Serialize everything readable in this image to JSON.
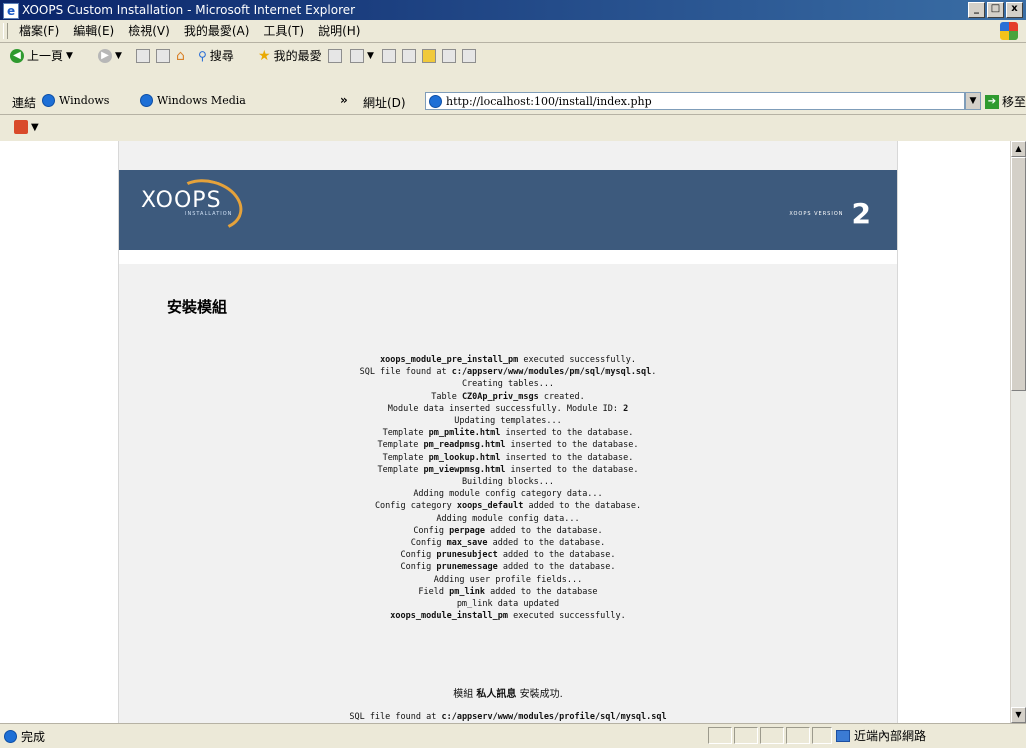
{
  "window": {
    "title": "XOOPS Custom Installation - Microsoft Internet Explorer",
    "min_label": "_",
    "max_label": "□",
    "close_label": "x"
  },
  "menu": [
    "檔案(F)",
    "編輯(E)",
    "檢視(V)",
    "我的最愛(A)",
    "工具(T)",
    "說明(H)"
  ],
  "toolbar": {
    "back_label": "上一頁",
    "search_label": "搜尋",
    "favorites_label": "我的最愛"
  },
  "links_bar": {
    "label": "連結",
    "links": [
      "Windows",
      "Windows Media"
    ],
    "chevron": "»"
  },
  "address": {
    "label": "網址(D)",
    "url": "http://localhost:100/install/index.php",
    "go_label": "移至"
  },
  "page": {
    "logo_text": "XOOPS",
    "logo_sub": "INSTALLATION",
    "version_label": "XOOPS VERSION",
    "version_number": "2",
    "heading": "安裝模組",
    "log_lines": [
      [
        {
          "b": "xoops_module_pre_install_pm"
        },
        {
          "t": " executed successfully."
        }
      ],
      [
        {
          "t": "SQL file found at "
        },
        {
          "b": "c:/appserv/www/modules/pm/sql/mysql.sql"
        },
        {
          "t": "."
        }
      ],
      [
        {
          "t": "Creating tables..."
        }
      ],
      [
        {
          "t": "Table "
        },
        {
          "b": "CZ0Ap_priv_msgs"
        },
        {
          "t": " created."
        }
      ],
      [
        {
          "t": "Module data inserted successfully. Module ID: "
        },
        {
          "b": "2"
        }
      ],
      [
        {
          "t": "Updating templates..."
        }
      ],
      [
        {
          "t": "Template "
        },
        {
          "b": "pm_pmlite.html"
        },
        {
          "t": " inserted to the database."
        }
      ],
      [
        {
          "t": "Template "
        },
        {
          "b": "pm_readpmsg.html"
        },
        {
          "t": " inserted to the database."
        }
      ],
      [
        {
          "t": "Template "
        },
        {
          "b": "pm_lookup.html"
        },
        {
          "t": " inserted to the database."
        }
      ],
      [
        {
          "t": "Template "
        },
        {
          "b": "pm_viewpmsg.html"
        },
        {
          "t": " inserted to the database."
        }
      ],
      [
        {
          "t": "Building blocks..."
        }
      ],
      [
        {
          "t": "Adding module config category data..."
        }
      ],
      [
        {
          "t": "Config category "
        },
        {
          "b": "xoops_default"
        },
        {
          "t": " added to the database."
        }
      ],
      [
        {
          "t": "Adding module config data..."
        }
      ],
      [
        {
          "t": "Config "
        },
        {
          "b": "perpage"
        },
        {
          "t": " added to the database."
        }
      ],
      [
        {
          "t": "Config "
        },
        {
          "b": "max_save"
        },
        {
          "t": " added to the database."
        }
      ],
      [
        {
          "t": "Config "
        },
        {
          "b": "prunesubject"
        },
        {
          "t": " added to the database."
        }
      ],
      [
        {
          "t": "Config "
        },
        {
          "b": "prunemessage"
        },
        {
          "t": " added to the database."
        }
      ],
      [
        {
          "t": "Adding user profile fields..."
        }
      ],
      [
        {
          "t": "Field "
        },
        {
          "b": "pm_link"
        },
        {
          "t": " added to the database"
        }
      ],
      [
        {
          "t": "pm_link data updated"
        }
      ],
      [
        {
          "b": "xoops_module_install_pm"
        },
        {
          "t": " executed successfully."
        }
      ]
    ],
    "success_prefix": "模組 ",
    "success_module": "私人訊息",
    "success_suffix": " 安裝成功.",
    "partial_line_prefix": "SQL file found at ",
    "partial_line_path": "c:/appserv/www/modules/profile/sql/mysql.sql"
  },
  "status": {
    "text": "完成",
    "zone": "近端內部網路"
  }
}
